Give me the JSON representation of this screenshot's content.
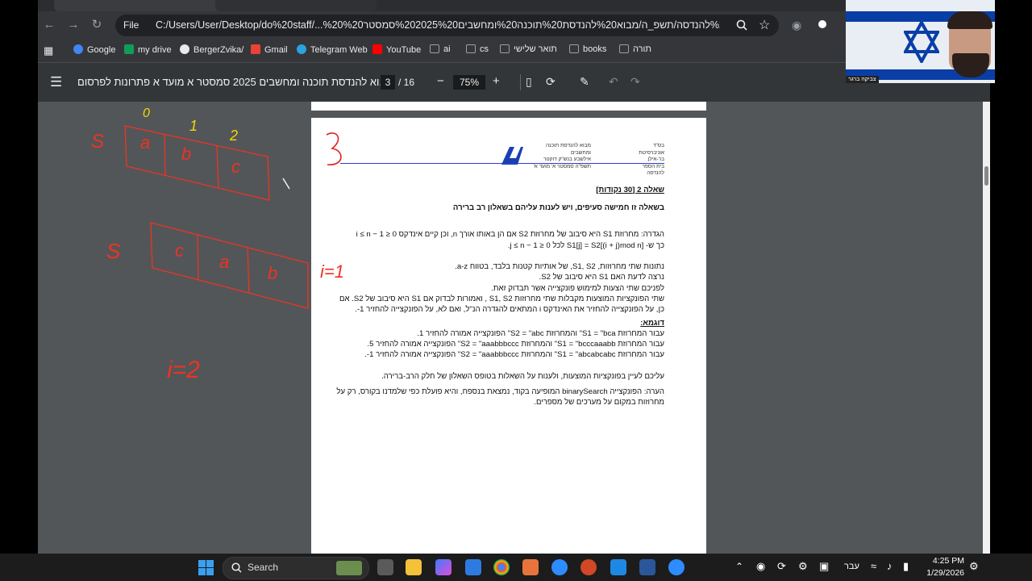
{
  "browser": {
    "tabs": [
      "",
      ""
    ],
    "file_label": "File",
    "url": "C:/Users/User/Desktop/do%20staff/...%20מרתונים/מבוא%20להנדסה/תשפ_ה/מבוא%20להנדסת%20תוכנה%20ומחשבים%202025%20סמסטר%20"
  },
  "bookmarks": [
    {
      "label": "Google",
      "icon": "google-icon",
      "color": "#4285f4"
    },
    {
      "label": "my drive",
      "icon": "drive-icon",
      "color": "#0f9d58"
    },
    {
      "label": "BergerZvika/",
      "icon": "github-icon",
      "color": "#e8eaed"
    },
    {
      "label": "Gmail",
      "icon": "gmail-icon",
      "color": "#ea4335"
    },
    {
      "label": "Telegram Web",
      "icon": "telegram-icon",
      "color": "#2aa3df"
    },
    {
      "label": "YouTube",
      "icon": "youtube-icon",
      "color": "#ff0000"
    },
    {
      "label": "ai",
      "icon": "folder-icon",
      "color": "#9aa0a6"
    },
    {
      "label": "cs",
      "icon": "folder-icon",
      "color": "#9aa0a6"
    },
    {
      "label": "תואר שלישי",
      "icon": "folder-icon",
      "color": "#9aa0a6"
    },
    {
      "label": "books",
      "icon": "folder-icon",
      "color": "#9aa0a6"
    },
    {
      "label": "תורה",
      "icon": "folder-icon",
      "color": "#9aa0a6"
    }
  ],
  "pdf": {
    "title": "וא להנדסת תוכנה ומחשבים 2025 סמסטר א מועד א פתרונות לפרסום...",
    "page": "3",
    "total": "/ 16",
    "zoom": "75%"
  },
  "doc": {
    "page_mark": "3",
    "header_right": [
      "בס\"ד",
      "אוניברסיטת בר-אילן",
      "בית הספר להנדסה"
    ],
    "header_left": [
      "מבוא להנדסת תוכנה ומחשבים",
      "אילשבע בנש\"ק דוקטר",
      "תשפ\"ה סמסטר א' מועד א'"
    ],
    "q_title": "שאלה 2 [30 נקודות]",
    "q_sub": "בשאלה זו חמישה סעיפים, ויש לענות עליהם בשאלון רב ברירה",
    "def1": "הגדרה: מחרוזת S1 היא סיבוב של מחרוזת S2 אם הן באותו אורך n, וכן קיים אינדקס 0 ≤ i ≤ n − 1",
    "def2": "כך ש-  S1[j] = S2[(i + j)mod n]  לכל 0 ≤ j ≤ n − 1.",
    "p1": "נתונות שתי מחרוזות, S1, S2, של אותיות קטנות בלבד, בטווח a-z.",
    "p2": "נרצה לדעת האם S1 היא סיבוב של S2.",
    "p3": "לפניכם שתי הצעות למימוש פונקצייה אשר תבדוק זאת.",
    "p4": "שתי הפונקציות המוצעות מקבלות שתי מחרוזות S1, S2 , ואמורות לבדוק אם S1 היא סיבוב של S2. אם",
    "p5": "כן, על הפונקצייה להחזיר את האינדקס i המתאים להגדרה הנ\"ל, ואם לא, על הפונקצייה להחזיר 1-.",
    "ex_title": "דוגמא:",
    "ex1": "עבור המחרוזת S1 = \"bca\" והמחרוזת S2 = \"abc\" הפונקצייה אמורה להחזיר 1.",
    "ex2": "עבור המחרוזת S1 = \"bcccaaabb\" והמחרוזת S2 = \"aaabbbccc\" הפונקצייה אמורה להחזיר 5.",
    "ex3": "עבור המחרוזת S1 = \"abcabcabc\" והמחרוזת S2 = \"aaabbbccc\" הפונקצייה אמורה להחזיר 1-.",
    "p6": "עליכם לעיין בפונקציות המוצעות, ולענות על השאלות בטופס השאלון של חלק הרב-ברירה.",
    "note1": "הערה: הפונקצייה binarySearch המופיעה בקוד, נמצאת בנספח, והיא פועלת כפי שלמדנו בקורס, רק על",
    "note2": "מחרוזות במקום על מערכים של מספרים."
  },
  "annotations": {
    "index0": "0",
    "index1": "1",
    "index2": "2",
    "s1": "S",
    "a": "a",
    "b": "b",
    "c": "c",
    "s2": "S",
    "c2": "c",
    "a2": "a",
    "b2": "b",
    "i1": "i=1",
    "i2": "i=2"
  },
  "webcam": {
    "name": "צביקה ברגר"
  },
  "taskbar": {
    "search": "Search",
    "lang": "עבר",
    "time": "4:25 PM",
    "date": "1/29/2026"
  }
}
